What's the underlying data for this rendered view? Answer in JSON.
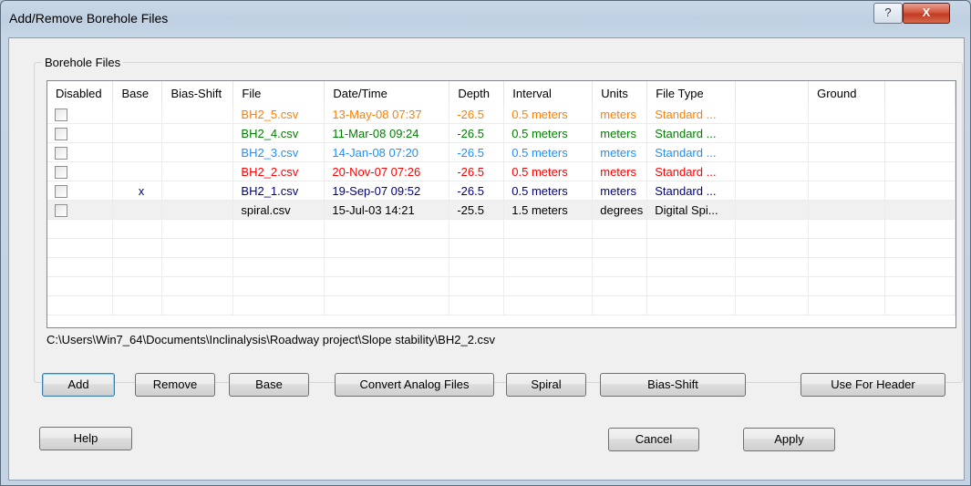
{
  "window": {
    "title": "Add/Remove Borehole Files",
    "help_glyph": "?",
    "close_glyph": "X"
  },
  "group": {
    "label": "Borehole Files"
  },
  "table": {
    "columns": [
      "Disabled",
      "Base",
      "Bias-Shift",
      "File",
      "Date/Time",
      "Depth",
      "Interval",
      "Units",
      "File Type",
      "",
      "Ground"
    ],
    "rows": [
      {
        "disabled": false,
        "base": "",
        "bias_shift": "",
        "file": "BH2_5.csv",
        "datetime": "13-May-08 07:37",
        "depth": "-26.5",
        "interval": "0.5 meters",
        "units": "meters",
        "file_type": "Standard ...",
        "extra": "",
        "ground": "",
        "color": "#ff8000"
      },
      {
        "disabled": false,
        "base": "",
        "bias_shift": "",
        "file": "BH2_4.csv",
        "datetime": "11-Mar-08 09:24",
        "depth": "-26.5",
        "interval": "0.5 meters",
        "units": "meters",
        "file_type": "Standard ...",
        "extra": "",
        "ground": "",
        "color": "#008000"
      },
      {
        "disabled": false,
        "base": "",
        "bias_shift": "",
        "file": "BH2_3.csv",
        "datetime": "14-Jan-08 07:20",
        "depth": "-26.5",
        "interval": "0.5 meters",
        "units": "meters",
        "file_type": "Standard ...",
        "extra": "",
        "ground": "",
        "color": "#1e90ff"
      },
      {
        "disabled": false,
        "base": "",
        "bias_shift": "",
        "file": "BH2_2.csv",
        "datetime": "20-Nov-07 07:26",
        "depth": "-26.5",
        "interval": "0.5 meters",
        "units": "meters",
        "file_type": "Standard ...",
        "extra": "",
        "ground": "",
        "color": "#ff0000"
      },
      {
        "disabled": false,
        "base": "x",
        "bias_shift": "",
        "file": "BH2_1.csv",
        "datetime": "19-Sep-07 09:52",
        "depth": "-26.5",
        "interval": "0.5 meters",
        "units": "meters",
        "file_type": "Standard ...",
        "extra": "",
        "ground": "",
        "color": "#000080"
      },
      {
        "disabled": false,
        "base": "",
        "bias_shift": "",
        "file": "spiral.csv",
        "datetime": "15-Jul-03 14:21",
        "depth": "-25.5",
        "interval": "1.5 meters",
        "units": "degrees",
        "file_type": "Digital Spi...",
        "extra": "",
        "ground": "",
        "color": "#000000"
      }
    ],
    "empty_rows": 5
  },
  "path": "C:\\Users\\Win7_64\\Documents\\Inclinalysis\\Roadway project\\Slope stability\\BH2_2.csv",
  "buttons": {
    "add": "Add",
    "remove": "Remove",
    "base": "Base",
    "convert": "Convert Analog Files",
    "spiral": "Spiral",
    "bias_shift": "Bias-Shift",
    "use_for_header": "Use For Header",
    "help": "Help",
    "cancel": "Cancel",
    "apply": "Apply"
  }
}
